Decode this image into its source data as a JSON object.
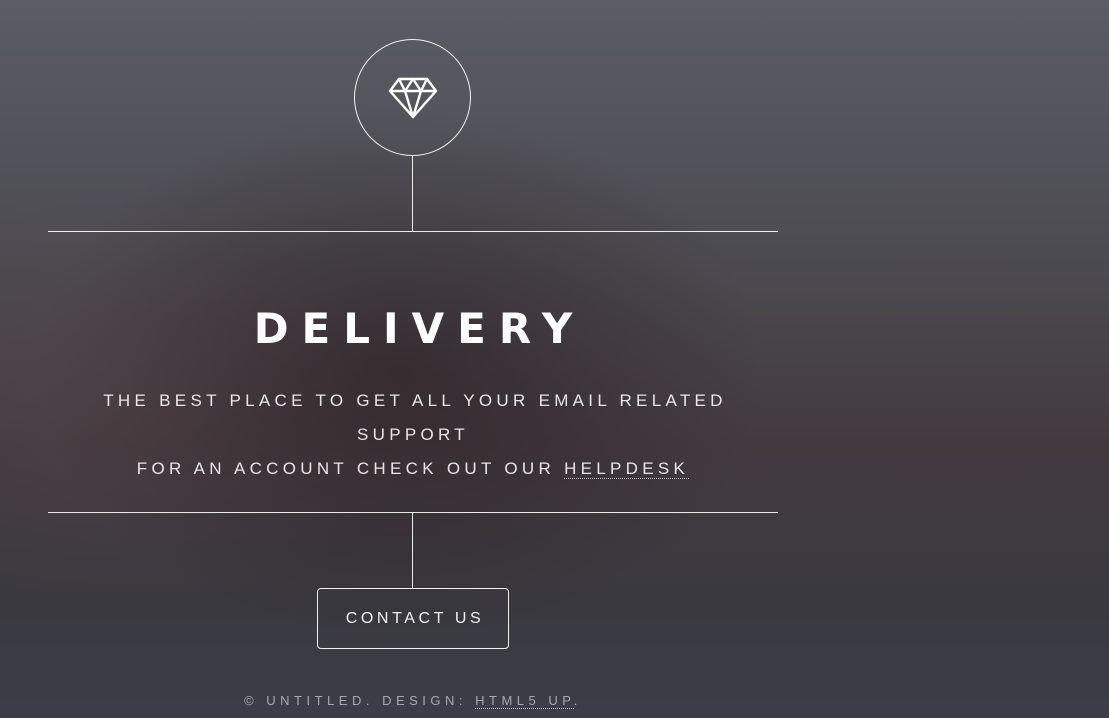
{
  "header": {
    "logo_icon": "diamond-icon"
  },
  "main": {
    "title": "DELIVERY",
    "tagline_line1": "THE BEST PLACE TO GET ALL YOUR EMAIL RELATED SUPPORT",
    "tagline_line2_prefix": "FOR AN ACCOUNT CHECK OUT OUR ",
    "tagline_link": "HELPDESK",
    "contact_button": "CONTACT US"
  },
  "footer": {
    "copyright_prefix": "© UNTITLED. DESIGN: ",
    "design_link": "HTML5 UP",
    "copyright_suffix": "."
  },
  "colors": {
    "foreground": "#ffffff",
    "background_top": "#5a5d66",
    "background_bottom": "#3b3e48"
  }
}
